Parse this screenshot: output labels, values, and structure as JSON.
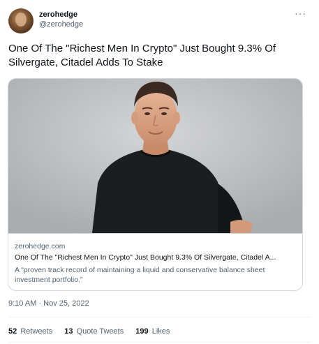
{
  "author": {
    "display_name": "zerohedge",
    "handle": "@zerohedge",
    "more_glyph": "···"
  },
  "tweet": {
    "text": "One Of The \"Richest Men In Crypto\" Just Bought 9.3% Of Silvergate, Citadel Adds To Stake",
    "timestamp": "9:10 AM · Nov 25, 2022"
  },
  "card": {
    "image_alt": "man-in-black-tshirt-photo",
    "domain": "zerohedge.com",
    "title": "One Of The \"Richest Men In Crypto\" Just Bought 9.3% Of Silvergate, Citadel A...",
    "description": "A “proven track record of maintaining a liquid and conservative balance sheet investment portfolio.”"
  },
  "stats": {
    "retweets_count": "52",
    "retweets_label": "Retweets",
    "quotes_count": "13",
    "quotes_label": "Quote Tweets",
    "likes_count": "199",
    "likes_label": "Likes"
  },
  "colors": {
    "text_primary": "#0f1419",
    "text_secondary": "#536471",
    "border": "#cfd9de"
  }
}
